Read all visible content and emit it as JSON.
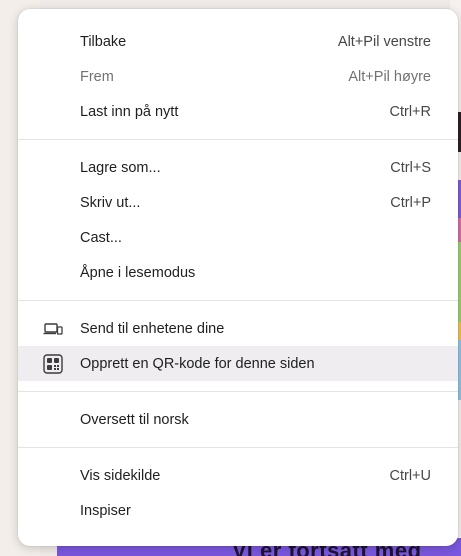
{
  "menu": {
    "groups": [
      {
        "items": [
          {
            "label": "Tilbake",
            "shortcut": "Alt+Pil venstre"
          },
          {
            "label": "Frem",
            "shortcut": "Alt+Pil høyre",
            "disabled": true
          },
          {
            "label": "Last inn på nytt",
            "shortcut": "Ctrl+R"
          }
        ]
      },
      {
        "items": [
          {
            "label": "Lagre som...",
            "shortcut": "Ctrl+S"
          },
          {
            "label": "Skriv ut...",
            "shortcut": "Ctrl+P"
          },
          {
            "label": "Cast...",
            "shortcut": ""
          },
          {
            "label": "Åpne i lesemodus",
            "shortcut": ""
          }
        ]
      },
      {
        "items": [
          {
            "label": "Send til enhetene dine",
            "shortcut": "",
            "icon": "devices-icon"
          },
          {
            "label": "Opprett en QR-kode for denne siden",
            "shortcut": "",
            "icon": "qr-code-icon",
            "hovered": true
          }
        ]
      },
      {
        "items": [
          {
            "label": "Oversett til norsk",
            "shortcut": ""
          }
        ]
      },
      {
        "items": [
          {
            "label": "Vis sidekilde",
            "shortcut": "Ctrl+U"
          },
          {
            "label": "Inspiser",
            "shortcut": ""
          }
        ]
      }
    ]
  },
  "colors": {
    "menu_bg": "#ffffff",
    "hover_bg": "#efedf0",
    "text": "#1f1f1f",
    "disabled_text": "#727272",
    "separator": "#e3e3e3",
    "page_accent": "#7a57dd"
  },
  "background": {
    "partial_heading": "Vi er fortsatt med"
  }
}
